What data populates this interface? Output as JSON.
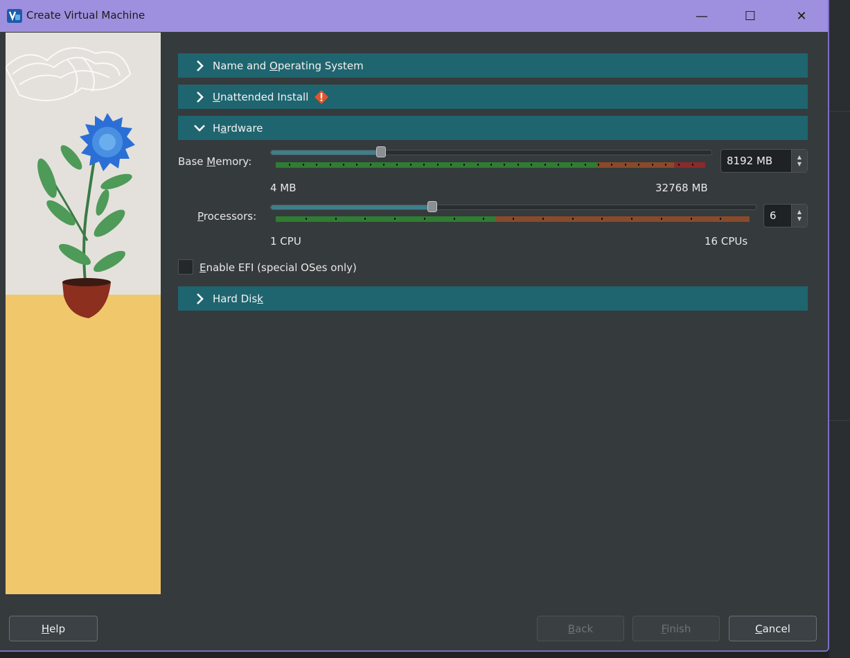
{
  "window": {
    "title": "Create Virtual Machine",
    "controls": {
      "minimize": "—",
      "maximize": "☐",
      "close": "✕"
    }
  },
  "sections": {
    "name_os": {
      "prefix": "Name and ",
      "accel": "O",
      "suffix": "perating System",
      "expanded": false
    },
    "unattended": {
      "prefix": "",
      "accel": "U",
      "suffix": "nattended Install",
      "expanded": false,
      "warning_icon": "warning-icon"
    },
    "hardware": {
      "prefix": "H",
      "accel": "a",
      "suffix": "rdware",
      "expanded": true
    },
    "hard_disk": {
      "prefix": "Hard Dis",
      "accel": "k",
      "suffix": "",
      "expanded": false
    }
  },
  "hardware": {
    "memory": {
      "label_prefix": "Base ",
      "label_accel": "M",
      "label_suffix": "emory:",
      "value": "8192 MB",
      "min_label": "4 MB",
      "max_label": "32768 MB",
      "fraction": 0.25
    },
    "processors": {
      "label_accel": "P",
      "label_suffix": "rocessors:",
      "value": "6",
      "min_label": "1 CPU",
      "max_label": "16 CPUs",
      "fraction": 0.3333
    },
    "efi": {
      "label_accel": "E",
      "label_suffix": "nable EFI (special OSes only)",
      "checked": false
    }
  },
  "footer": {
    "help": {
      "accel": "H",
      "suffix": "elp"
    },
    "back": {
      "accel": "B",
      "suffix": "ack",
      "enabled": false
    },
    "finish": {
      "accel": "F",
      "suffix": "inish",
      "enabled": false
    },
    "cancel": {
      "accel": "C",
      "suffix": "ancel"
    }
  },
  "colors": {
    "titlebar": "#9e90de",
    "section_bar": "#1f6570",
    "scale_green": "#2e7d32",
    "scale_orange": "#8a4a2a",
    "scale_red": "#8b2a2a"
  }
}
